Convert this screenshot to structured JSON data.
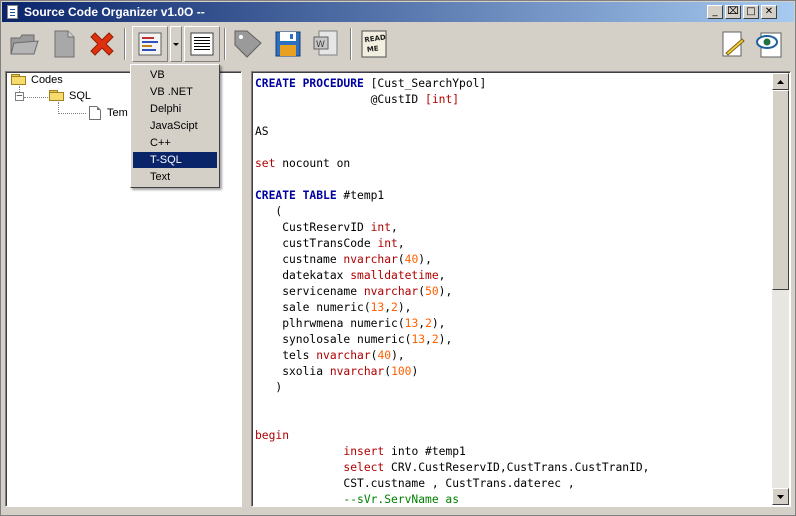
{
  "window": {
    "title": "Source Code Organizer v1.0O --",
    "controls": {
      "minimize": "_",
      "restore": "⌧",
      "maximize": "□",
      "close": "✕"
    }
  },
  "toolbar": {
    "buttons": [
      {
        "name": "open",
        "icon": "open-folder-icon"
      },
      {
        "name": "new",
        "icon": "new-document-icon"
      },
      {
        "name": "delete",
        "icon": "delete-x-icon"
      },
      {
        "name": "language",
        "icon": "language-list-icon"
      },
      {
        "name": "view",
        "icon": "list-view-icon"
      },
      {
        "name": "tag",
        "icon": "tag-icon"
      },
      {
        "name": "save",
        "icon": "floppy-disk-icon"
      },
      {
        "name": "export-word",
        "icon": "word-document-icon"
      },
      {
        "name": "readme",
        "icon": "readme-icon",
        "label": "READ ME"
      },
      {
        "name": "notes",
        "icon": "notepad-icon"
      },
      {
        "name": "preview",
        "icon": "eye-icon"
      }
    ]
  },
  "tree": {
    "root": "Codes",
    "folder": "SQL",
    "item": "Tem"
  },
  "language_menu": {
    "items": [
      "VB",
      "VB .NET",
      "Delphi",
      "JavaScipt",
      "C++",
      "T-SQL",
      "Text"
    ],
    "selected": "T-SQL"
  },
  "editor": {
    "lines": [
      [
        {
          "t": "CREATE PROCEDURE",
          "c": "kw"
        },
        {
          "t": " [Cust_SearchYpol]",
          "c": ""
        }
      ],
      [
        {
          "t": "                 @CustID ",
          "c": ""
        },
        {
          "t": "[int]",
          "c": "kr"
        }
      ],
      [],
      [
        {
          "t": "AS",
          "c": ""
        }
      ],
      [],
      [
        {
          "t": "set",
          "c": "kr"
        },
        {
          "t": " nocount on",
          "c": ""
        }
      ],
      [],
      [
        {
          "t": "CREATE TABLE",
          "c": "kw"
        },
        {
          "t": " #temp1",
          "c": ""
        }
      ],
      [
        {
          "t": "   (",
          "c": ""
        }
      ],
      [
        {
          "t": "    CustReservID ",
          "c": ""
        },
        {
          "t": "int",
          "c": "kr"
        },
        {
          "t": ",",
          "c": ""
        }
      ],
      [
        {
          "t": "    custTransCode ",
          "c": ""
        },
        {
          "t": "int",
          "c": "kr"
        },
        {
          "t": ",",
          "c": ""
        }
      ],
      [
        {
          "t": "    custname ",
          "c": ""
        },
        {
          "t": "nvarchar",
          "c": "kr"
        },
        {
          "t": "(",
          "c": ""
        },
        {
          "t": "40",
          "c": "num"
        },
        {
          "t": "),",
          "c": ""
        }
      ],
      [
        {
          "t": "    datekatax ",
          "c": ""
        },
        {
          "t": "smalldatetime",
          "c": "kr"
        },
        {
          "t": ",",
          "c": ""
        }
      ],
      [
        {
          "t": "    servicename ",
          "c": ""
        },
        {
          "t": "nvarchar",
          "c": "kr"
        },
        {
          "t": "(",
          "c": ""
        },
        {
          "t": "50",
          "c": "num"
        },
        {
          "t": "),",
          "c": ""
        }
      ],
      [
        {
          "t": "    sale numeric(",
          "c": ""
        },
        {
          "t": "13",
          "c": "num"
        },
        {
          "t": ",",
          "c": ""
        },
        {
          "t": "2",
          "c": "num"
        },
        {
          "t": "),",
          "c": ""
        }
      ],
      [
        {
          "t": "    plhrwmena numeric(",
          "c": ""
        },
        {
          "t": "13",
          "c": "num"
        },
        {
          "t": ",",
          "c": ""
        },
        {
          "t": "2",
          "c": "num"
        },
        {
          "t": "),",
          "c": ""
        }
      ],
      [
        {
          "t": "    synolosale numeric(",
          "c": ""
        },
        {
          "t": "13",
          "c": "num"
        },
        {
          "t": ",",
          "c": ""
        },
        {
          "t": "2",
          "c": "num"
        },
        {
          "t": "),",
          "c": ""
        }
      ],
      [
        {
          "t": "    tels ",
          "c": ""
        },
        {
          "t": "nvarchar",
          "c": "kr"
        },
        {
          "t": "(",
          "c": ""
        },
        {
          "t": "40",
          "c": "num"
        },
        {
          "t": "),",
          "c": ""
        }
      ],
      [
        {
          "t": "    sxolia ",
          "c": ""
        },
        {
          "t": "nvarchar",
          "c": "kr"
        },
        {
          "t": "(",
          "c": ""
        },
        {
          "t": "100",
          "c": "num"
        },
        {
          "t": ")",
          "c": ""
        }
      ],
      [
        {
          "t": "   )",
          "c": ""
        }
      ],
      [],
      [],
      [
        {
          "t": "begin",
          "c": "kr"
        }
      ],
      [
        {
          "t": "             ",
          "c": ""
        },
        {
          "t": "insert",
          "c": "kr"
        },
        {
          "t": " into #temp1",
          "c": ""
        }
      ],
      [
        {
          "t": "             ",
          "c": ""
        },
        {
          "t": "select",
          "c": "kr"
        },
        {
          "t": " CRV.CustReservID,CustTrans.CustTranID,",
          "c": ""
        }
      ],
      [
        {
          "t": "             CST.custname , CustTrans.daterec ,",
          "c": ""
        }
      ],
      [
        {
          "t": "             --sVr.ServName as",
          "c": "cm"
        }
      ]
    ]
  },
  "colors": {
    "keyword": "#0000a0",
    "builtin": "#b00000",
    "number": "#ff6000",
    "comment": "#008000",
    "selection": "#0a246a"
  }
}
